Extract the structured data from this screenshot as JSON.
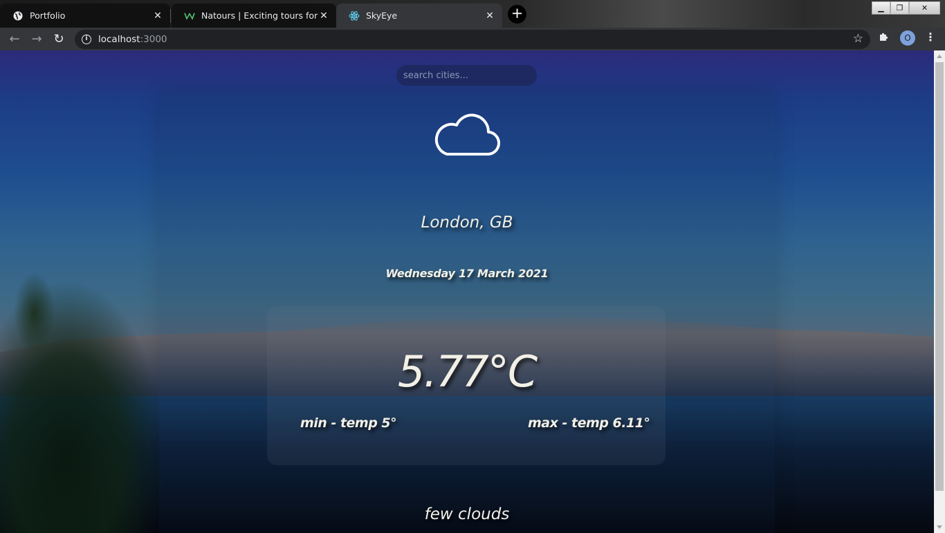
{
  "browser": {
    "tabs": [
      {
        "title": "Portfolio",
        "active": false
      },
      {
        "title": "Natours | Exciting tours for adver",
        "active": false
      },
      {
        "title": "SkyEye",
        "active": true
      }
    ],
    "new_tab_label": "+",
    "address": {
      "host": "localhost",
      "port": ":3000"
    },
    "profile_initial": "O",
    "window_controls": {
      "minimize": "▁",
      "restore": "❐",
      "close": "✕"
    }
  },
  "app": {
    "search": {
      "placeholder": "search cities...",
      "value": ""
    },
    "weather_icon": "cloud-icon",
    "location": "London, GB",
    "date": "Wednesday 17 March 2021",
    "temperature": "5.77°C",
    "min_temp": "min - temp 5°",
    "max_temp": "max - temp 6.11°",
    "description": "few clouds"
  },
  "colors": {
    "text": "#f2f0e6",
    "chrome_bg": "#35363a",
    "omnibox_bg": "#202124"
  }
}
